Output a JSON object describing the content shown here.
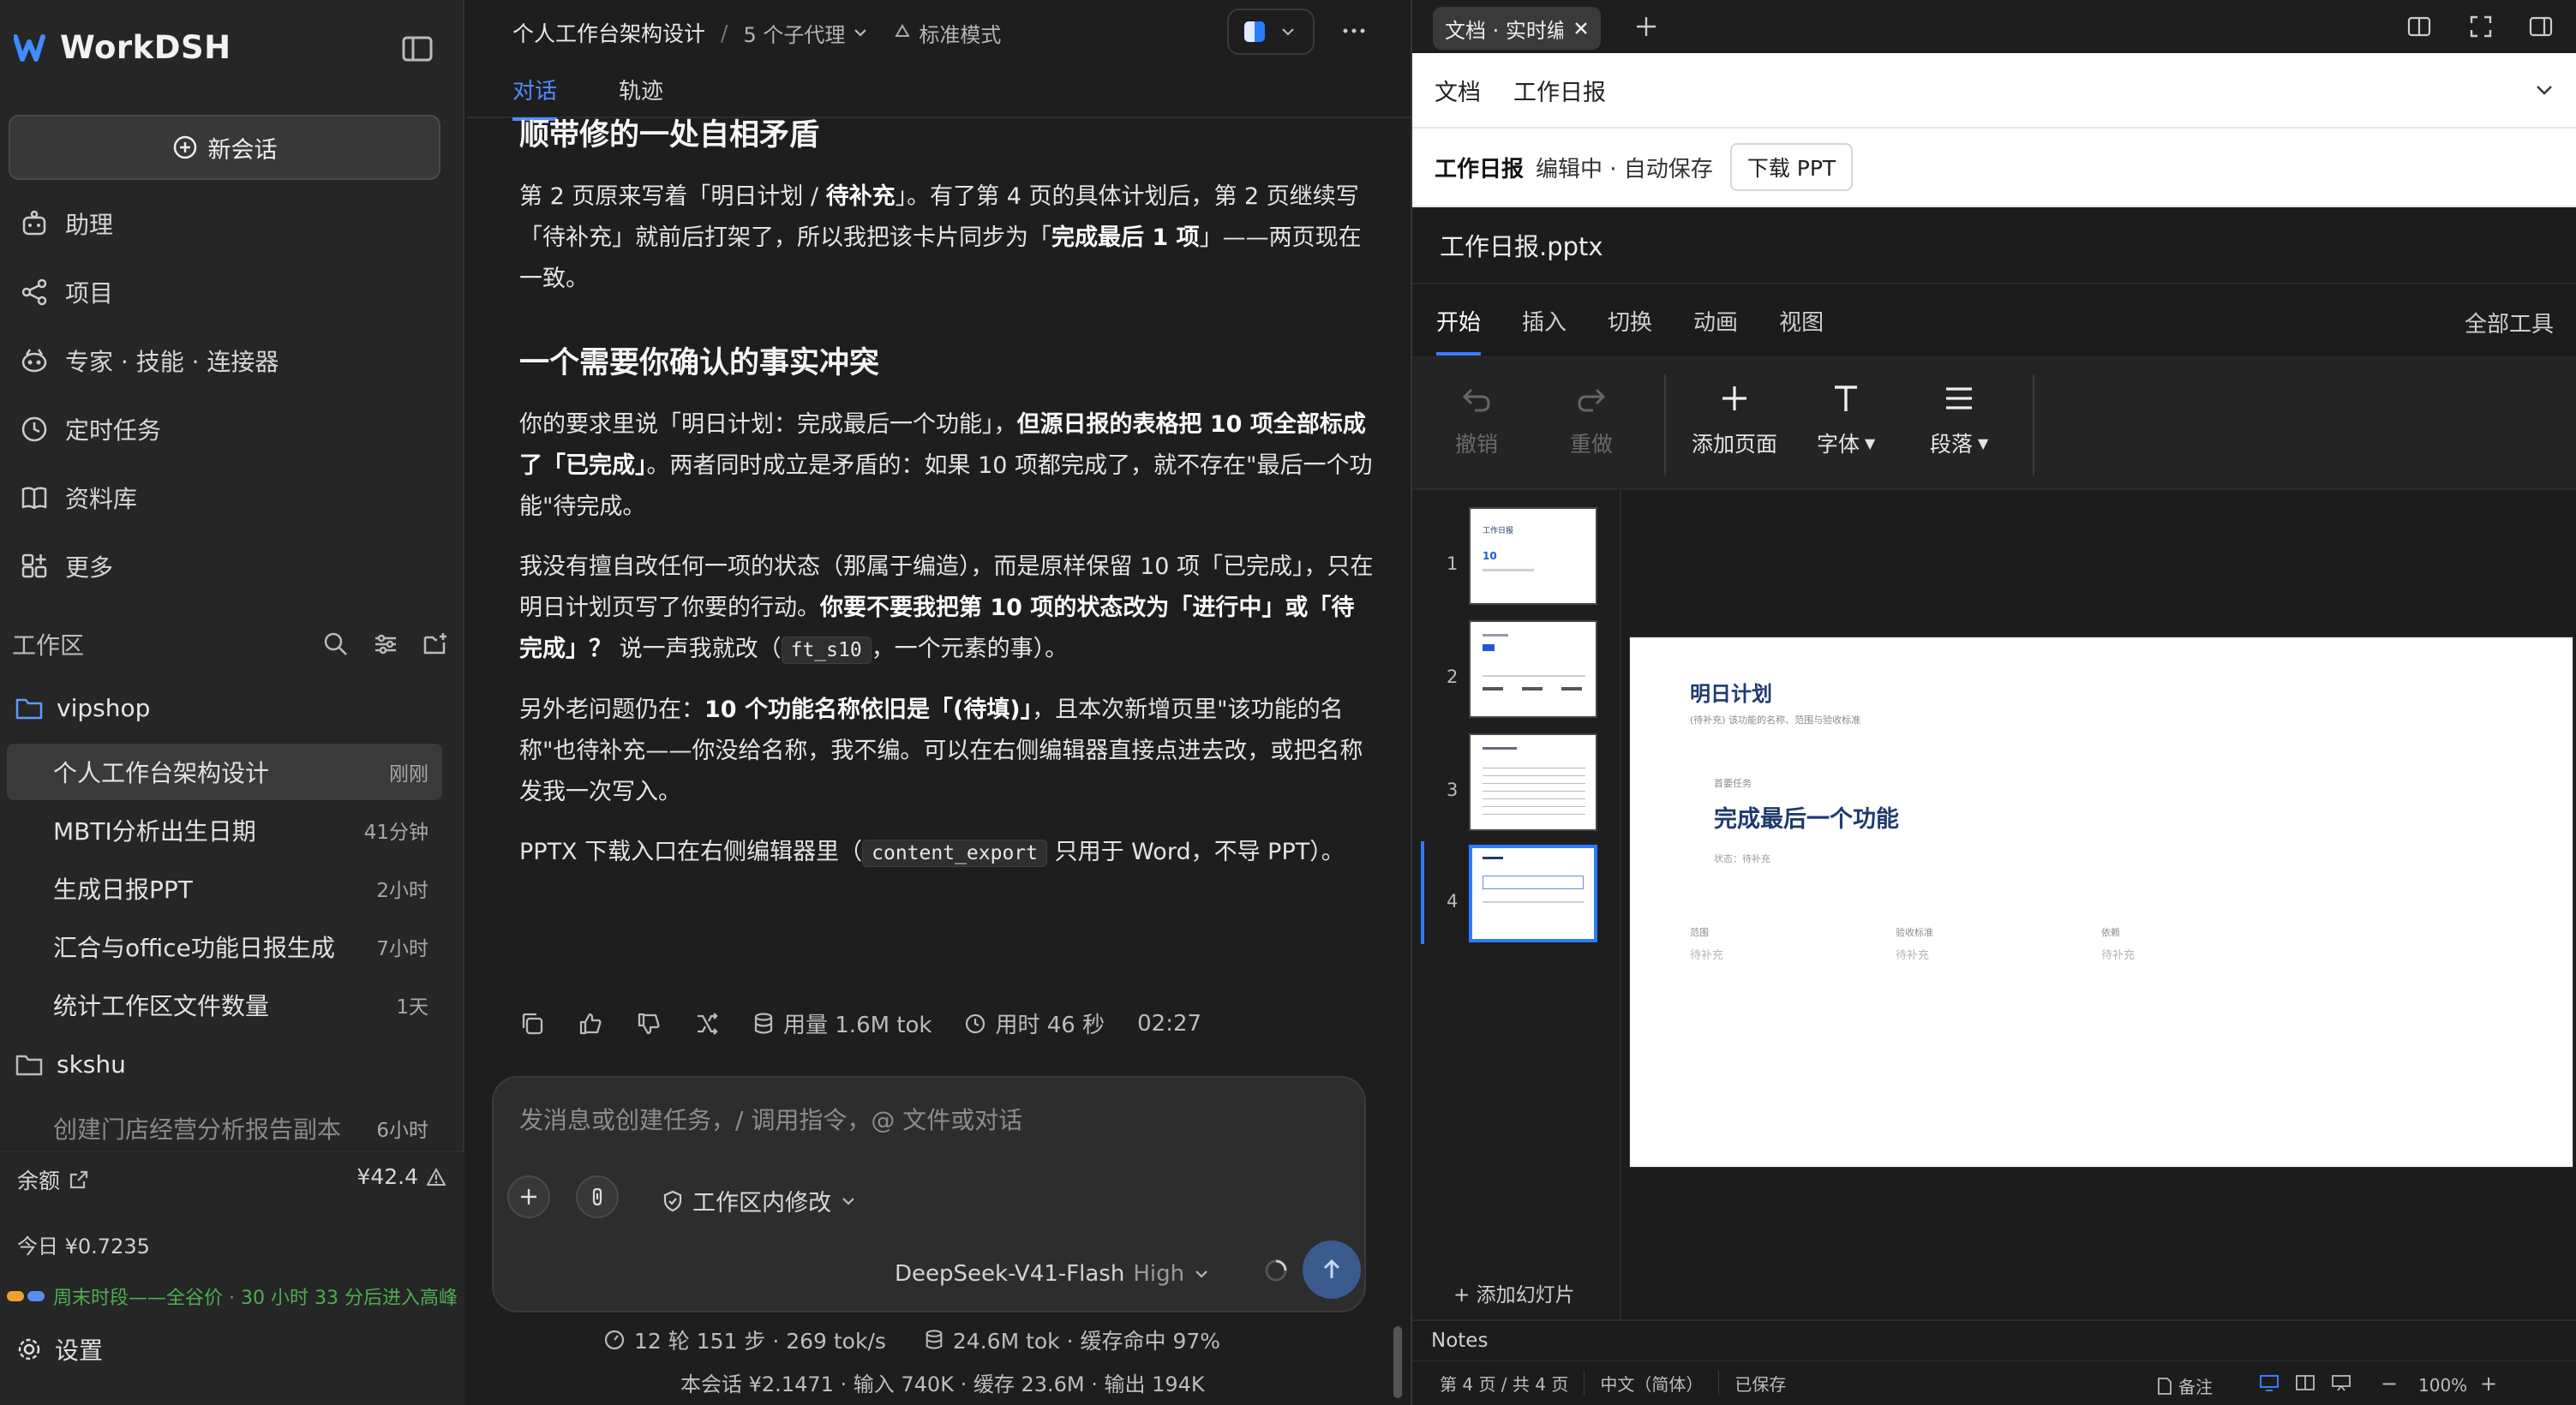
{
  "app": {
    "name": "WorkDSH",
    "new_chat": "新会话"
  },
  "nav": [
    {
      "label": "助理",
      "icon": "assistant-icon"
    },
    {
      "label": "项目",
      "icon": "share-icon"
    },
    {
      "label": "专家 · 技能 · 连接器",
      "icon": "robot-icon"
    },
    {
      "label": "定时任务",
      "icon": "clock-icon"
    },
    {
      "label": "资料库",
      "icon": "book-icon"
    },
    {
      "label": "更多",
      "icon": "apps-icon"
    }
  ],
  "workspace": {
    "title": "工作区",
    "folders": [
      {
        "name": "vipshop",
        "items": [
          {
            "title": "个人工作台架构设计",
            "time": "刚刚",
            "active": true
          },
          {
            "title": "MBTI分析出生日期",
            "time": "41分钟"
          },
          {
            "title": "生成日报PPT",
            "time": "2小时"
          },
          {
            "title": "汇合与office功能日报生成",
            "time": "7小时"
          },
          {
            "title": "统计工作区文件数量",
            "time": "1天"
          }
        ]
      },
      {
        "name": "skshu",
        "items": [
          {
            "title": "创建门店经营分析报告副本",
            "time": "6小时"
          }
        ]
      }
    ]
  },
  "footer": {
    "balance_label": "余额",
    "balance_value": "¥42.4",
    "today": "今日 ¥0.7235",
    "promo": "周末时段——全谷价 · 30 小时 33 分后进入高峰",
    "settings": "设置"
  },
  "chat": {
    "title": "个人工作台架构设计",
    "agents": "5 个子代理",
    "mode": "标准模式",
    "tabs": [
      "对话",
      "轨迹"
    ],
    "h1": "顺带修的一处自相矛盾",
    "p1a": "第 2 页原来写着「明日计划 / ",
    "p1b": "待补充",
    "p1c": "」。有了第 4 页的具体计划后，第 2 页继续写「待补充」就前后打架了，所以我把该卡片同步为「",
    "p1d": "完成最后 1 项",
    "p1e": "」——两页现在一致。",
    "h2": "一个需要你确认的事实冲突",
    "p2a": "你的要求里说「明日计划：完成最后一个功能」，",
    "p2b": "但源日报的表格把 10 项全部标成了「已完成」",
    "p2c": "。两者同时成立是矛盾的：如果 10 项都完成了，就不存在\"最后一个功能\"待完成。",
    "p3a": "我没有擅自改任何一项的状态（那属于编造），而是原样保留 10 项「已完成」，只在明日计划页写了你要的行动。",
    "p3b": "你要不要我把第 10 项的状态改为「进行中」或「待完成」？",
    "p3c": " 说一声我就改（",
    "p3code": "ft_s10",
    "p3d": "，一个元素的事）。",
    "p4a": "另外老问题仍在：",
    "p4b": "10 个功能名称依旧是「(待填)」",
    "p4c": "，且本次新增页里\"该功能的名称\"也待补充——你没给名称，我不编。可以在右侧编辑器直接点进去改，或把名称发我一次写入。",
    "p5a": "PPTX 下载入口在右侧编辑器里（",
    "p5code": "content_export",
    "p5b": " 只用于 Word，不导 PPT）。",
    "usage": "用量 1.6M tok",
    "duration": "用时 46 秒",
    "clock": "02:27",
    "input_placeholder": "发消息或创建任务，/ 调用指令，@ 文件或对话",
    "scope": "工作区内修改",
    "model": "DeepSeek-V41-Flash",
    "level": "High",
    "stats_steps": "12 轮 151 步 · 269 tok/s",
    "stats_tokens": "24.6M tok · 缓存命中 97%",
    "stats_session": "本会话 ¥2.1471 · 输入 740K · 缓存 23.6M · 输出 194K"
  },
  "right": {
    "tab_label": "文档 · 实时编",
    "doc_tabs": [
      "文档",
      "工作日报"
    ],
    "bar_title": "工作日报",
    "bar_status": "编辑中 · 自动保存",
    "download": "下载 PPT",
    "file": "工作日报.pptx",
    "ribbon_tabs": [
      "开始",
      "插入",
      "切换",
      "动画",
      "视图"
    ],
    "all_tools": "全部工具",
    "tools": {
      "undo": "撤销",
      "redo": "重做",
      "add_page": "添加页面",
      "font": "字体",
      "paragraph": "段落"
    },
    "add_slide": "+ 添加幻灯片",
    "notes": "Notes",
    "status": {
      "page": "第 4 页 / 共 4 页",
      "lang": "中文（简体）",
      "saved": "已保存",
      "remark": "备注",
      "zoom": "100%"
    },
    "slide": {
      "title": "明日计划",
      "subtitle": "(待补充) 该功能的名称、范围与验收标准",
      "kicker": "首要任务",
      "headline": "完成最后一个功能",
      "state": "状态：待补充",
      "cols": [
        {
          "label": "范围",
          "value": "待补充"
        },
        {
          "label": "验收标准",
          "value": "待补充"
        },
        {
          "label": "依赖",
          "value": "待补充"
        }
      ]
    },
    "thumb_numbers": [
      "1",
      "2",
      "3",
      "4"
    ],
    "thumb1": {
      "title": "工作日报",
      "big": "10"
    }
  },
  "colors": {
    "accent": "#4c8dff",
    "slide_title": "#1f3a6e",
    "promo": "#4caf50"
  }
}
